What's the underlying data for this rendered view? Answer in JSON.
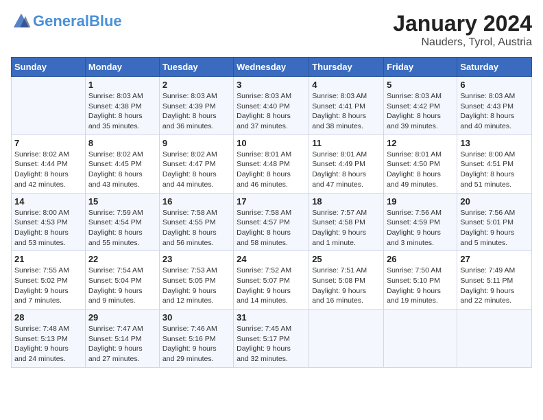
{
  "logo": {
    "line1": "General",
    "line2": "Blue"
  },
  "title": "January 2024",
  "subtitle": "Nauders, Tyrol, Austria",
  "days_of_week": [
    "Sunday",
    "Monday",
    "Tuesday",
    "Wednesday",
    "Thursday",
    "Friday",
    "Saturday"
  ],
  "weeks": [
    [
      {
        "day": "",
        "info": ""
      },
      {
        "day": "1",
        "info": "Sunrise: 8:03 AM\nSunset: 4:38 PM\nDaylight: 8 hours\nand 35 minutes."
      },
      {
        "day": "2",
        "info": "Sunrise: 8:03 AM\nSunset: 4:39 PM\nDaylight: 8 hours\nand 36 minutes."
      },
      {
        "day": "3",
        "info": "Sunrise: 8:03 AM\nSunset: 4:40 PM\nDaylight: 8 hours\nand 37 minutes."
      },
      {
        "day": "4",
        "info": "Sunrise: 8:03 AM\nSunset: 4:41 PM\nDaylight: 8 hours\nand 38 minutes."
      },
      {
        "day": "5",
        "info": "Sunrise: 8:03 AM\nSunset: 4:42 PM\nDaylight: 8 hours\nand 39 minutes."
      },
      {
        "day": "6",
        "info": "Sunrise: 8:03 AM\nSunset: 4:43 PM\nDaylight: 8 hours\nand 40 minutes."
      }
    ],
    [
      {
        "day": "7",
        "info": "Sunrise: 8:02 AM\nSunset: 4:44 PM\nDaylight: 8 hours\nand 42 minutes."
      },
      {
        "day": "8",
        "info": "Sunrise: 8:02 AM\nSunset: 4:45 PM\nDaylight: 8 hours\nand 43 minutes."
      },
      {
        "day": "9",
        "info": "Sunrise: 8:02 AM\nSunset: 4:47 PM\nDaylight: 8 hours\nand 44 minutes."
      },
      {
        "day": "10",
        "info": "Sunrise: 8:01 AM\nSunset: 4:48 PM\nDaylight: 8 hours\nand 46 minutes."
      },
      {
        "day": "11",
        "info": "Sunrise: 8:01 AM\nSunset: 4:49 PM\nDaylight: 8 hours\nand 47 minutes."
      },
      {
        "day": "12",
        "info": "Sunrise: 8:01 AM\nSunset: 4:50 PM\nDaylight: 8 hours\nand 49 minutes."
      },
      {
        "day": "13",
        "info": "Sunrise: 8:00 AM\nSunset: 4:51 PM\nDaylight: 8 hours\nand 51 minutes."
      }
    ],
    [
      {
        "day": "14",
        "info": "Sunrise: 8:00 AM\nSunset: 4:53 PM\nDaylight: 8 hours\nand 53 minutes."
      },
      {
        "day": "15",
        "info": "Sunrise: 7:59 AM\nSunset: 4:54 PM\nDaylight: 8 hours\nand 55 minutes."
      },
      {
        "day": "16",
        "info": "Sunrise: 7:58 AM\nSunset: 4:55 PM\nDaylight: 8 hours\nand 56 minutes."
      },
      {
        "day": "17",
        "info": "Sunrise: 7:58 AM\nSunset: 4:57 PM\nDaylight: 8 hours\nand 58 minutes."
      },
      {
        "day": "18",
        "info": "Sunrise: 7:57 AM\nSunset: 4:58 PM\nDaylight: 9 hours\nand 1 minute."
      },
      {
        "day": "19",
        "info": "Sunrise: 7:56 AM\nSunset: 4:59 PM\nDaylight: 9 hours\nand 3 minutes."
      },
      {
        "day": "20",
        "info": "Sunrise: 7:56 AM\nSunset: 5:01 PM\nDaylight: 9 hours\nand 5 minutes."
      }
    ],
    [
      {
        "day": "21",
        "info": "Sunrise: 7:55 AM\nSunset: 5:02 PM\nDaylight: 9 hours\nand 7 minutes."
      },
      {
        "day": "22",
        "info": "Sunrise: 7:54 AM\nSunset: 5:04 PM\nDaylight: 9 hours\nand 9 minutes."
      },
      {
        "day": "23",
        "info": "Sunrise: 7:53 AM\nSunset: 5:05 PM\nDaylight: 9 hours\nand 12 minutes."
      },
      {
        "day": "24",
        "info": "Sunrise: 7:52 AM\nSunset: 5:07 PM\nDaylight: 9 hours\nand 14 minutes."
      },
      {
        "day": "25",
        "info": "Sunrise: 7:51 AM\nSunset: 5:08 PM\nDaylight: 9 hours\nand 16 minutes."
      },
      {
        "day": "26",
        "info": "Sunrise: 7:50 AM\nSunset: 5:10 PM\nDaylight: 9 hours\nand 19 minutes."
      },
      {
        "day": "27",
        "info": "Sunrise: 7:49 AM\nSunset: 5:11 PM\nDaylight: 9 hours\nand 22 minutes."
      }
    ],
    [
      {
        "day": "28",
        "info": "Sunrise: 7:48 AM\nSunset: 5:13 PM\nDaylight: 9 hours\nand 24 minutes."
      },
      {
        "day": "29",
        "info": "Sunrise: 7:47 AM\nSunset: 5:14 PM\nDaylight: 9 hours\nand 27 minutes."
      },
      {
        "day": "30",
        "info": "Sunrise: 7:46 AM\nSunset: 5:16 PM\nDaylight: 9 hours\nand 29 minutes."
      },
      {
        "day": "31",
        "info": "Sunrise: 7:45 AM\nSunset: 5:17 PM\nDaylight: 9 hours\nand 32 minutes."
      },
      {
        "day": "",
        "info": ""
      },
      {
        "day": "",
        "info": ""
      },
      {
        "day": "",
        "info": ""
      }
    ]
  ]
}
